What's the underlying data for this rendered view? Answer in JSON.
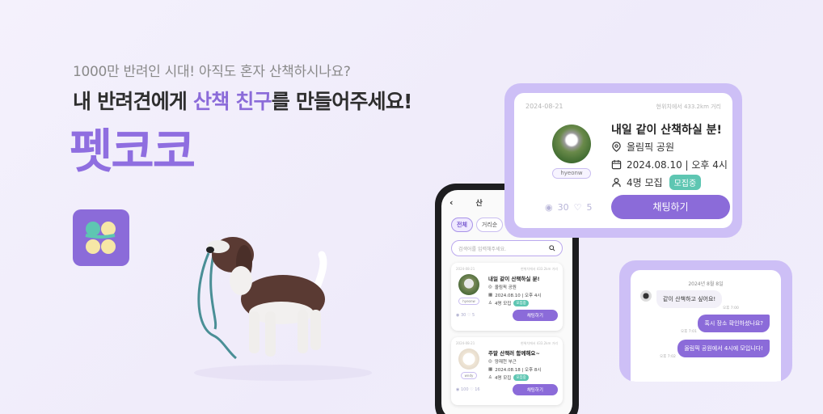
{
  "hero": {
    "subtitle": "1000만 반려인 시대! 아직도 혼자 산책하시나요?",
    "title_pre": "내 반려견에게 ",
    "title_accent": "산책 친구",
    "title_post": "를 만들어주세요!",
    "brand": "펫코코"
  },
  "phone": {
    "back_icon": "‹",
    "header_title": "산",
    "tabs": [
      "전체",
      "거리순",
      ""
    ],
    "search_placeholder": "검색어를 입력해주세요.",
    "cards": [
      {
        "date": "2024-08-21",
        "distance": "현위치에서 433.2km 거리",
        "title": "내일 같이 산책하실 분!",
        "place": "올림픽 공원",
        "datetime": "2024.08.10 | 오후 4시",
        "members": "4명 모집",
        "badge": "모집중",
        "user": "hyeonw",
        "views": "30",
        "likes": "5",
        "button": "채팅하기"
      },
      {
        "date": "2024-08-21",
        "distance": "현위치에서 433.2km 거리",
        "title": "주말 산책러 함께해요~",
        "place": "양재천 부근",
        "datetime": "2024.08.18 | 오후 8시",
        "members": "4명 모집",
        "badge": "모집중",
        "user": "wndy",
        "views": "100",
        "likes": "16",
        "button": "채팅하기"
      }
    ]
  },
  "big_card": {
    "date": "2024-08-21",
    "distance": "현위치에서 433.2km 거리",
    "title": "내일 같이 산책하실 분!",
    "place": "올림픽 공원",
    "datetime": "2024.08.10 | 오후 4시",
    "members": "4명 모집",
    "badge": "모집중",
    "user": "hyeonw",
    "views": "30",
    "likes": "5",
    "button": "채팅하기"
  },
  "chat": {
    "date": "2024년 8월 8일",
    "messages": [
      {
        "text": "같이 산책하고 싶어요!",
        "time": "오후 7:00"
      },
      {
        "text": "혹시 장소 확인하셨나요?",
        "time": "오후 7:01"
      },
      {
        "text": "올림픽 공원에서 4시에 모입니다!",
        "time": "오후 7:02"
      }
    ]
  },
  "colors": {
    "accent": "#8b6bd9",
    "badge": "#5ec6b2",
    "frame": "#cdbff6",
    "background": "#f2eefb"
  }
}
